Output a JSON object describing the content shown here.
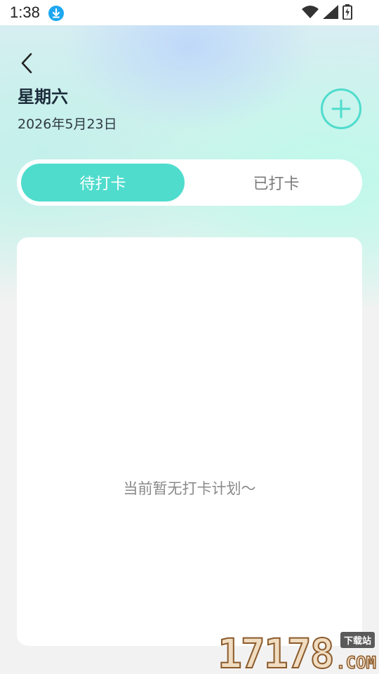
{
  "status_bar": {
    "time": "1:38",
    "icons": [
      "download-icon",
      "wifi-icon",
      "signal-icon",
      "battery-charging-icon"
    ]
  },
  "header": {
    "back_icon": "chevron-left-icon",
    "title": "星期六",
    "date": "2026年5月23日",
    "add_icon": "plus-circle-icon"
  },
  "tabs": {
    "pending_label": "待打卡",
    "done_label": "已打卡",
    "active": "pending"
  },
  "content": {
    "empty_message": "当前暂无打卡计划～"
  },
  "watermark": {
    "number": "17178",
    "badge": "下载站",
    "suffix": ".COM"
  },
  "colors": {
    "accent": "#4fdccd",
    "title": "#1b2b3a",
    "muted_text": "#8a8a8a"
  }
}
